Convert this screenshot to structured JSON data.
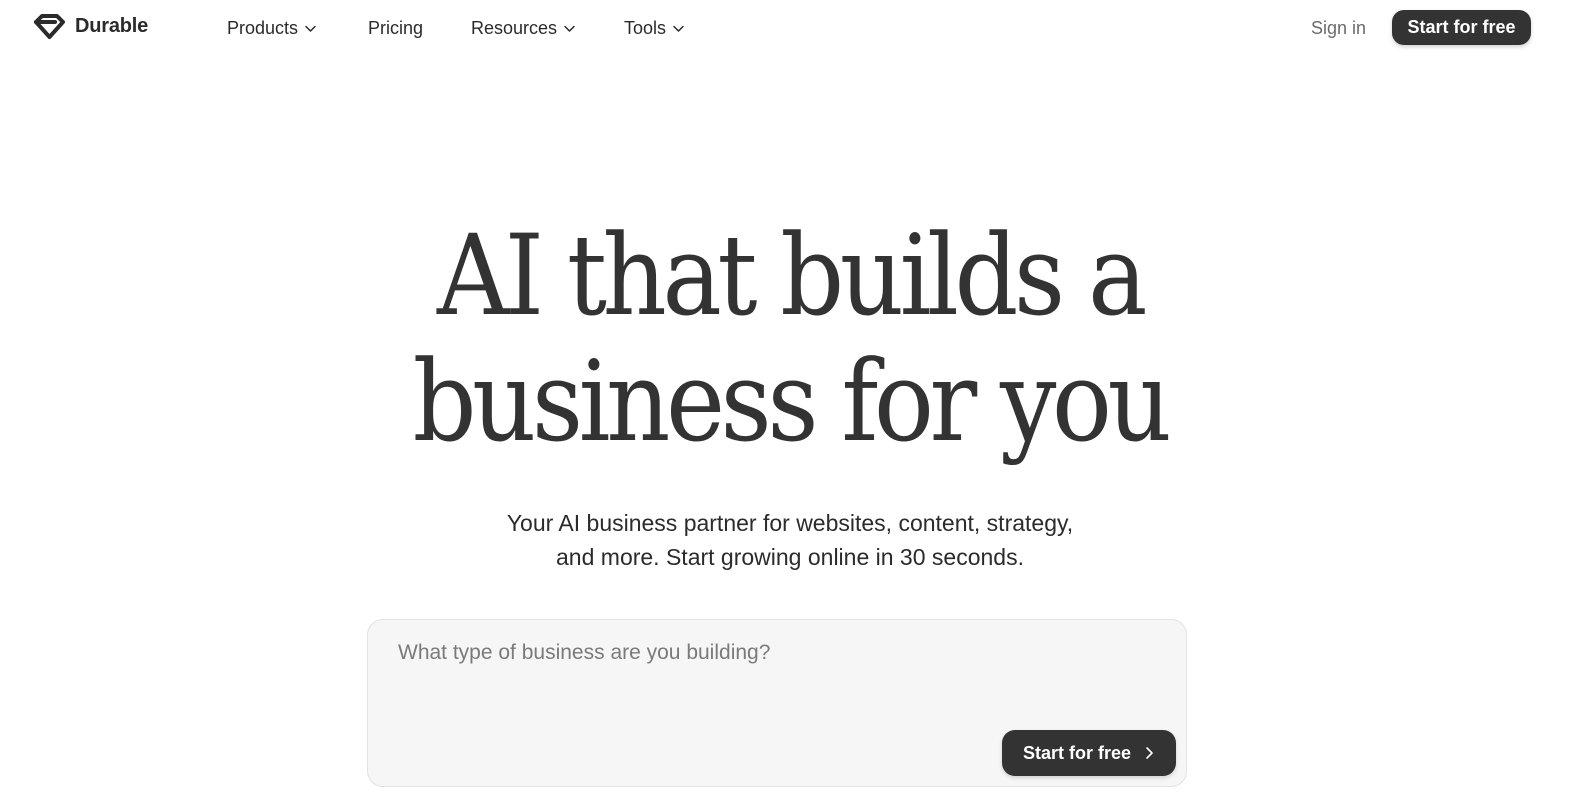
{
  "brand": {
    "name": "Durable",
    "logo_icon": "diamond-logo-icon"
  },
  "nav": {
    "products": {
      "label": "Products",
      "icon": "chevron-down-icon"
    },
    "pricing": {
      "label": "Pricing"
    },
    "resources": {
      "label": "Resources",
      "icon": "chevron-down-icon"
    },
    "tools": {
      "label": "Tools",
      "icon": "chevron-down-icon"
    }
  },
  "header": {
    "signin_label": "Sign in",
    "cta_label": "Start for free"
  },
  "hero": {
    "title_lines": [
      "AI that builds a",
      "business for you"
    ],
    "subtitle_lines": [
      "Your AI business partner for websites, content, strategy,",
      "and more. Start growing online in 30 seconds."
    ]
  },
  "prompt": {
    "placeholder": "What type of business are you building?",
    "value": "",
    "cta_label": "Start for free",
    "cta_icon": "chevron-right-icon"
  },
  "colors": {
    "text": "#2b2b2b",
    "muted": "#6b6b6b",
    "button_bg": "#333333",
    "button_text": "#ffffff",
    "input_bg": "#f6f6f6",
    "input_border": "#e2e2e2"
  }
}
